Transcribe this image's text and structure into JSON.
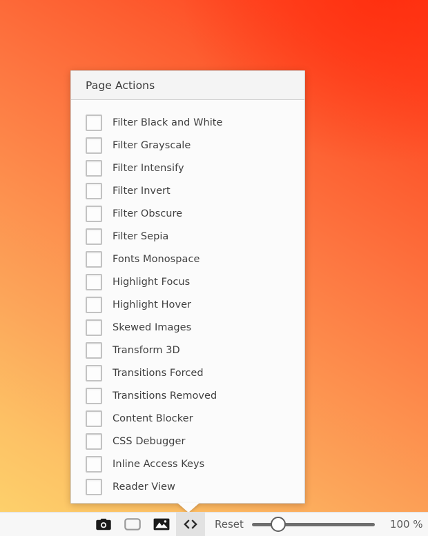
{
  "background": {
    "name": "warm-gradient-wallpaper",
    "colors": {
      "bottom_left": "#fdd06b",
      "middle": "#fd8e4d",
      "top_right": "#ff3a18"
    }
  },
  "popup": {
    "title": "Page Actions",
    "actions": [
      {
        "label": "Filter Black and White",
        "checked": false
      },
      {
        "label": "Filter Grayscale",
        "checked": false
      },
      {
        "label": "Filter Intensify",
        "checked": false
      },
      {
        "label": "Filter Invert",
        "checked": false
      },
      {
        "label": "Filter Obscure",
        "checked": false
      },
      {
        "label": "Filter Sepia",
        "checked": false
      },
      {
        "label": "Fonts Monospace",
        "checked": false
      },
      {
        "label": "Highlight Focus",
        "checked": false
      },
      {
        "label": "Highlight Hover",
        "checked": false
      },
      {
        "label": "Skewed Images",
        "checked": false
      },
      {
        "label": "Transform 3D",
        "checked": false
      },
      {
        "label": "Transitions Forced",
        "checked": false
      },
      {
        "label": "Transitions Removed",
        "checked": false
      },
      {
        "label": "Content Blocker",
        "checked": false
      },
      {
        "label": "CSS Debugger",
        "checked": false
      },
      {
        "label": "Inline Access Keys",
        "checked": false
      },
      {
        "label": "Reader View",
        "checked": false
      }
    ]
  },
  "toolbar": {
    "buttons": [
      {
        "icon": "camera-icon",
        "name": "screenshot-button",
        "active": false
      },
      {
        "icon": "window-icon",
        "name": "viewport-button",
        "active": false
      },
      {
        "icon": "image-icon",
        "name": "full-page-image-button",
        "active": false
      },
      {
        "icon": "code-icon",
        "name": "page-actions-button",
        "active": true
      }
    ],
    "reset_label": "Reset",
    "zoom_value": "100 %",
    "zoom_percent": 100,
    "slider": {
      "min": 0,
      "max": 100,
      "value": 100,
      "thumb_position_ratio": 0.15
    }
  }
}
